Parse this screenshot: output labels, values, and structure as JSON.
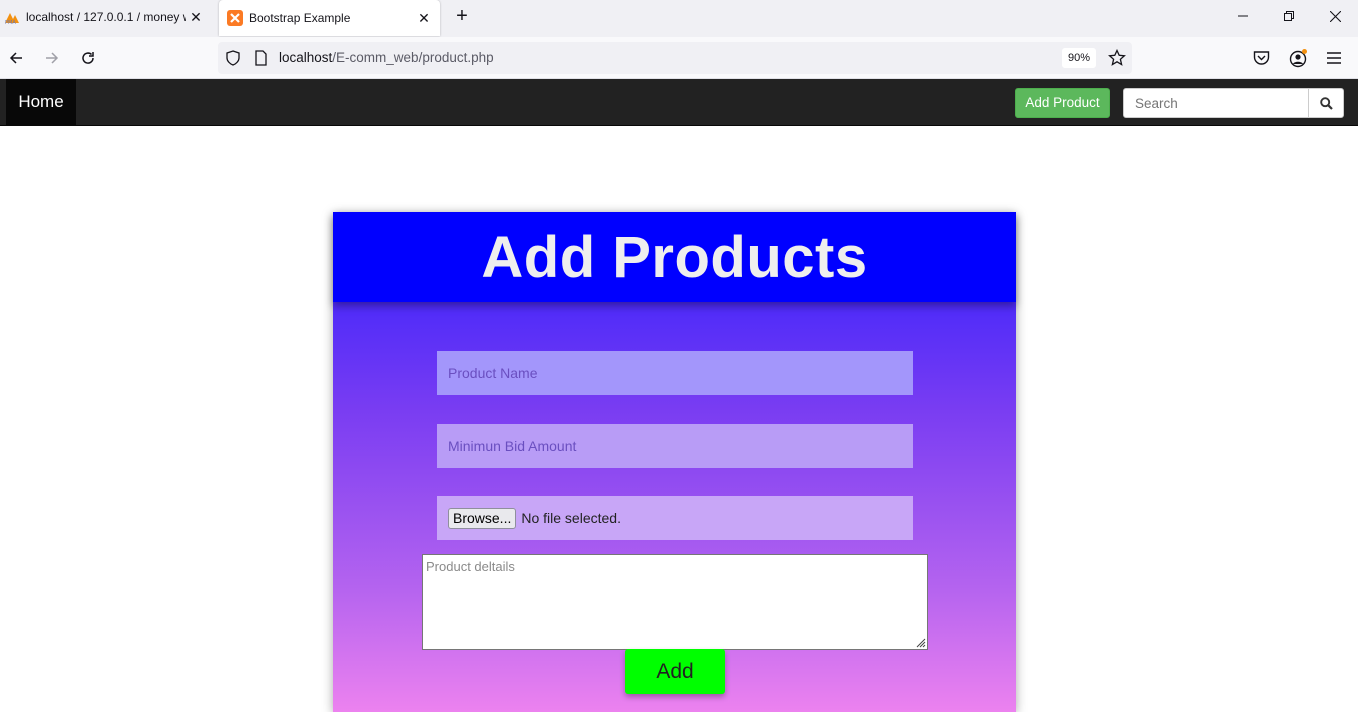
{
  "browser": {
    "tabs": [
      {
        "title": "localhost / 127.0.0.1 / money wa",
        "active": false
      },
      {
        "title": "Bootstrap Example",
        "active": true
      }
    ],
    "url_host": "localhost",
    "url_path": "/E-comm_web/product.php",
    "zoom": "90%"
  },
  "navbar": {
    "brand": "Home",
    "add_product_label": "Add Product",
    "search_placeholder": "Search"
  },
  "form": {
    "title": "Add Products",
    "product_name_placeholder": "Product Name",
    "bid_placeholder": "Minimun Bid Amount",
    "browse_label": "Browse...",
    "file_status": "No file selected.",
    "details_placeholder": "Product deltails",
    "submit_label": "Add"
  },
  "colors": {
    "navbar_bg": "#222222",
    "add_product_bg": "#5cb85c",
    "card_header_bg": "#0000ff",
    "submit_bg": "#00ff00"
  }
}
